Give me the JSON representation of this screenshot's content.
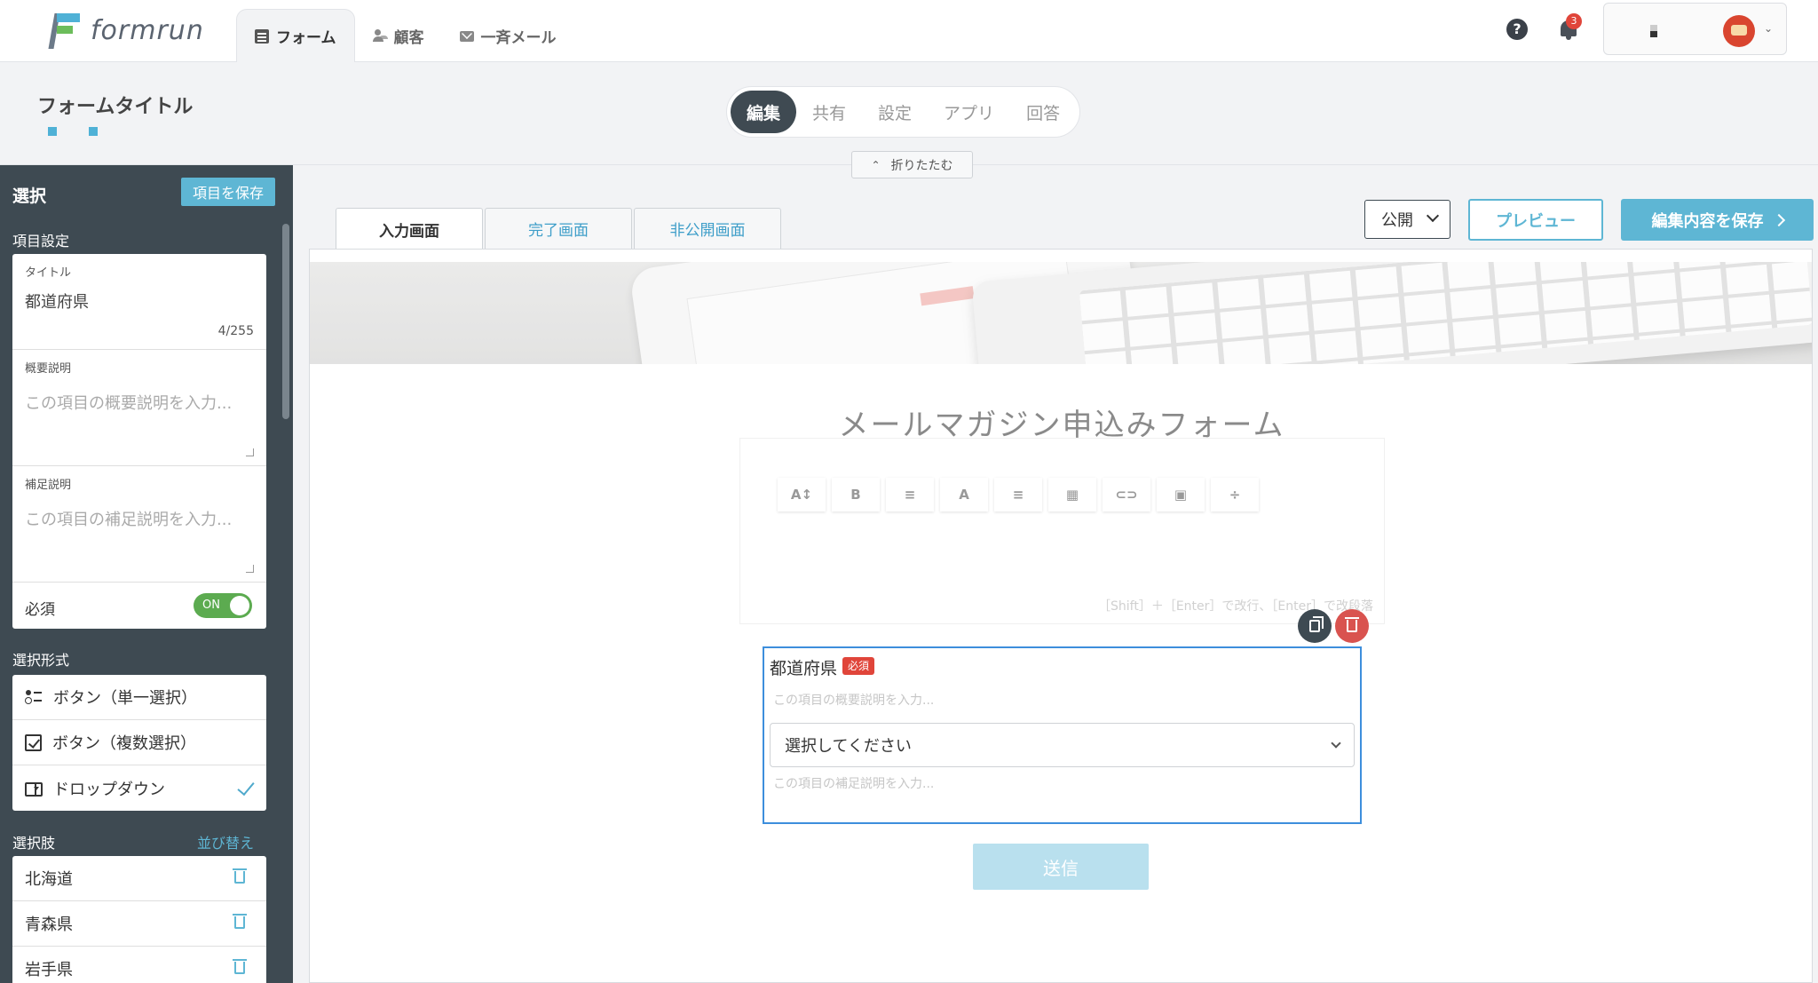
{
  "app": {
    "logo_text": "formrun"
  },
  "nav": {
    "tabs": [
      {
        "label": "フォーム",
        "icon": "document-icon",
        "active": true
      },
      {
        "label": "顧客",
        "icon": "people-icon",
        "active": false
      },
      {
        "label": "一斉メール",
        "icon": "mail-icon",
        "active": false
      }
    ],
    "notifications_count": "3",
    "help_label": "?"
  },
  "titlebar": {
    "form_title": "フォームタイトル",
    "mode_tabs": [
      "編集",
      "共有",
      "設定",
      "アプリ",
      "回答"
    ],
    "active_mode": "編集",
    "collapse_label": "折りたたむ"
  },
  "sidebar": {
    "heading": "選択",
    "save_item_label": "項目を保存",
    "item_settings_label": "項目設定",
    "title_label": "タイトル",
    "title_value": "都道府県",
    "title_count": "4/255",
    "summary_label": "概要説明",
    "summary_placeholder": "この項目の概要説明を入力...",
    "supplement_label": "補足説明",
    "supplement_placeholder": "この項目の補足説明を入力...",
    "required_label": "必須",
    "required_toggle": "ON",
    "selection_format_label": "選択形式",
    "format_options": [
      {
        "label": "ボタン（単一選択）",
        "icon": "radio-list-icon",
        "selected": false
      },
      {
        "label": "ボタン（複数選択）",
        "icon": "checkbox-icon",
        "selected": false
      },
      {
        "label": "ドロップダウン",
        "icon": "dropdown-icon",
        "selected": true
      }
    ],
    "choices_label": "選択肢",
    "sort_label": "並び替え",
    "choices": [
      "北海道",
      "青森県",
      "岩手県"
    ]
  },
  "main": {
    "screen_tabs": [
      {
        "label": "入力画面",
        "active": true
      },
      {
        "label": "完了画面",
        "active": false
      },
      {
        "label": "非公開画面",
        "active": false
      }
    ],
    "publish_value": "公開",
    "preview_label": "プレビュー",
    "save_edit_label": "編集内容を保存",
    "form_heading": "メールマガジン申込みフォーム",
    "editor_tools": [
      "A↕",
      "B",
      "≡",
      "A",
      "≡",
      "▦",
      "⊂⊃",
      "▣",
      "÷"
    ],
    "editor_hint": "［Shift］＋［Enter］で改行、［Enter］で改段落",
    "field": {
      "title": "都道府県",
      "required_badge": "必須",
      "description_placeholder": "この項目の概要説明を入力...",
      "select_placeholder": "選択してください",
      "supplement_placeholder": "この項目の補足説明を入力..."
    },
    "submit_label": "送信"
  },
  "colors": {
    "accent": "#5eb6d4",
    "sidebar_bg": "#3e4a52",
    "toggle_on": "#5cab50",
    "danger": "#e0453a",
    "focus_border": "#3d8edc"
  }
}
